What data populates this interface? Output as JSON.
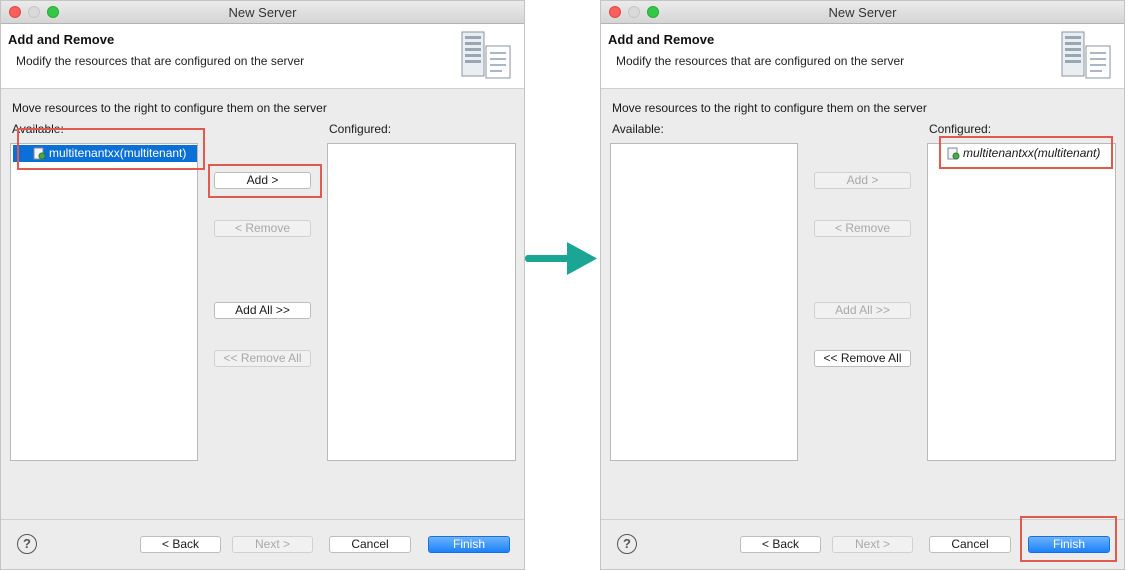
{
  "windows": [
    {
      "title": "New Server",
      "banner": {
        "heading": "Add and Remove",
        "description": "Modify the resources that are configured on the server"
      },
      "instruction": "Move resources to the right to configure them on the server",
      "available_label": "Available:",
      "configured_label": "Configured:",
      "available_items": [
        "multitenantxx(multitenant)"
      ],
      "configured_items": [],
      "buttons": {
        "add": "Add >",
        "remove": "< Remove",
        "add_all": "Add All >>",
        "remove_all": "<< Remove All"
      },
      "footer": {
        "back": "< Back",
        "next": "Next >",
        "cancel": "Cancel",
        "finish": "Finish"
      }
    },
    {
      "title": "New Server",
      "banner": {
        "heading": "Add and Remove",
        "description": "Modify the resources that are configured on the server"
      },
      "instruction": "Move resources to the right to configure them on the server",
      "available_label": "Available:",
      "configured_label": "Configured:",
      "available_items": [],
      "configured_items": [
        "multitenantxx(multitenant)"
      ],
      "buttons": {
        "add": "Add >",
        "remove": "< Remove",
        "add_all": "Add All >>",
        "remove_all": "<< Remove All"
      },
      "footer": {
        "back": "< Back",
        "next": "Next >",
        "cancel": "Cancel",
        "finish": "Finish"
      }
    }
  ],
  "help_symbol": "?",
  "colors": {
    "highlight": "#e05a50",
    "arrow": "#1aa595",
    "selection": "#0a6fd6",
    "primary_button": "#1a82fb"
  }
}
